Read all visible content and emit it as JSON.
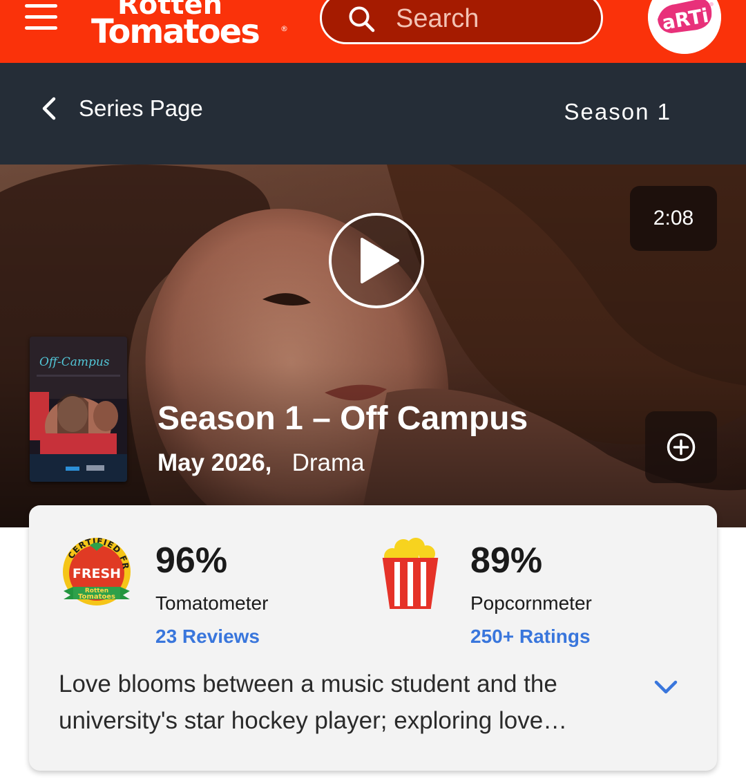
{
  "header": {
    "logo_text": "Rotten Tomatoes",
    "search_placeholder": "Search",
    "avatar_text": "aRTi",
    "accent_color": "#fa320a"
  },
  "subnav": {
    "back_label": "Series Page",
    "season_label": "Season 1"
  },
  "hero": {
    "duration": "2:08",
    "title": "Season 1 – Off Campus",
    "date": "May 2026,",
    "genre": "Drama",
    "poster_title": "Off-Campus"
  },
  "scores": {
    "tomatometer": {
      "badge_text": "CERTIFIED FRESH",
      "value": "96%",
      "label": "Tomatometer",
      "link": "23 Reviews"
    },
    "popcornmeter": {
      "value": "89%",
      "label": "Popcornmeter",
      "link": "250+ Ratings"
    }
  },
  "synopsis": "Love blooms between a music student and the university's star hockey player; exploring love…"
}
